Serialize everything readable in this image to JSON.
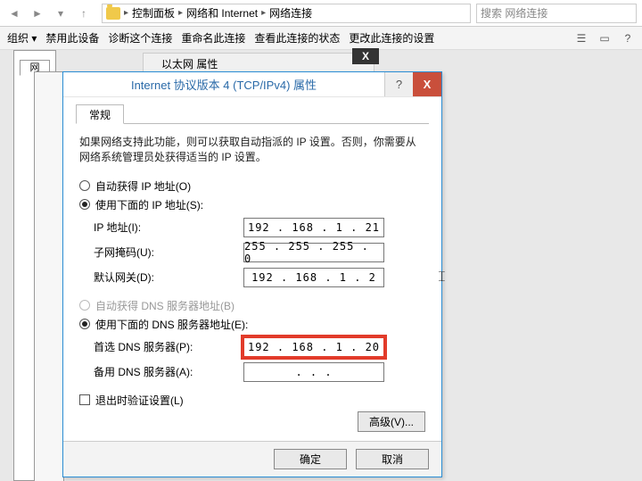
{
  "addressbar": {
    "crumbs": [
      "控制面板",
      "网络和 Internet",
      "网络连接"
    ],
    "search_placeholder": "搜索 网络连接"
  },
  "toolbar": {
    "organize": "组织 ▾",
    "disable": "禁用此设备",
    "diagnose": "诊断这个连接",
    "rename": "重命名此连接",
    "status": "查看此连接的状态",
    "change": "更改此连接的设置"
  },
  "behind_tab": {
    "label": "以太网 属性",
    "close": "X"
  },
  "left_tab": "网",
  "dialog": {
    "title": "Internet 协议版本 4 (TCP/IPv4) 属性",
    "help": "?",
    "close": "X",
    "tab_general": "常规",
    "description": "如果网络支持此功能，则可以获取自动指派的 IP 设置。否则，你需要从网络系统管理员处获得适当的 IP 设置。",
    "radio_auto_ip": "自动获得 IP 地址(O)",
    "radio_manual_ip": "使用下面的 IP 地址(S):",
    "ip_label": "IP 地址(I):",
    "ip_value": "192 . 168 .  1  . 21",
    "mask_label": "子网掩码(U):",
    "mask_value": "255 . 255 . 255 .  0",
    "gw_label": "默认网关(D):",
    "gw_value": "192 . 168 .  1  .  2",
    "radio_auto_dns": "自动获得 DNS 服务器地址(B)",
    "radio_manual_dns": "使用下面的 DNS 服务器地址(E):",
    "dns1_label": "首选 DNS 服务器(P):",
    "dns1_value": "192 . 168 .  1  . 20",
    "dns2_label": "备用 DNS 服务器(A):",
    "dns2_value": " .       .       .  ",
    "validate_exit": "退出时验证设置(L)",
    "advanced": "高级(V)...",
    "ok": "确定",
    "cancel": "取消"
  }
}
